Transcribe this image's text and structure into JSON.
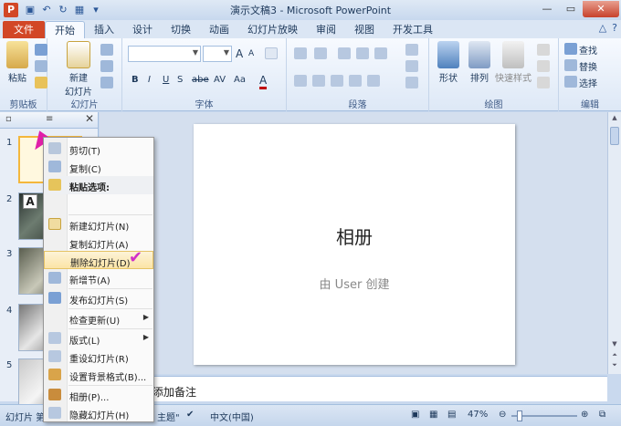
{
  "window": {
    "title": "演示文稿3 - Microsoft PowerPoint",
    "app_icon": "P",
    "controls": [
      "—",
      "▭",
      "✕"
    ]
  },
  "qat": [
    "save-icon",
    "undo-icon",
    "redo-icon",
    "slideshow-icon",
    "customize-icon"
  ],
  "tabs": [
    {
      "label": "文件"
    },
    {
      "label": "开始"
    },
    {
      "label": "插入"
    },
    {
      "label": "设计"
    },
    {
      "label": "切换"
    },
    {
      "label": "动画"
    },
    {
      "label": "幻灯片放映"
    },
    {
      "label": "审阅"
    },
    {
      "label": "视图"
    },
    {
      "label": "开发工具"
    }
  ],
  "ribbon": {
    "clipboard": {
      "label": "剪贴板",
      "paste": "粘贴"
    },
    "slides": {
      "label": "幻灯片",
      "new_slide": "新建\n幻灯片"
    },
    "font": {
      "label": "字体",
      "bold": "B",
      "italic": "I",
      "underline": "U",
      "strike": "S",
      "abc": "abe",
      "av": "AV",
      "aa": "Aa",
      "a_color": "A",
      "grow": "A",
      "shrink": "A"
    },
    "paragraph": {
      "label": "段落"
    },
    "drawing": {
      "label": "绘图",
      "shapes": "形状",
      "arrange": "排列",
      "quick_styles": "快速样式"
    },
    "editing": {
      "label": "编辑",
      "find": "查找",
      "replace": "替换",
      "select": "选择"
    }
  },
  "slides": [
    {
      "num": "1"
    },
    {
      "num": "2"
    },
    {
      "num": "3"
    },
    {
      "num": "4"
    },
    {
      "num": "5"
    }
  ],
  "slide": {
    "title": "相册",
    "subtitle": "由 User 创建"
  },
  "notes": {
    "placeholder": "添加备注"
  },
  "status": {
    "slide_info": "幻灯片 第",
    "theme": "主题\"",
    "language": "中文(中国)",
    "zoom": "47%"
  },
  "context_menu": {
    "items": [
      {
        "label": "剪切(T)",
        "icon": "scissors-icon"
      },
      {
        "label": "复制(C)",
        "icon": "copy-icon"
      },
      {
        "label": "粘贴选项:",
        "icon": "paste-icon",
        "header": true
      },
      {
        "label": "新建幻灯片(N)",
        "icon": "new-slide-icon"
      },
      {
        "label": "复制幻灯片(A)",
        "icon": ""
      },
      {
        "label": "删除幻灯片(D)",
        "icon": "",
        "highlight": true
      },
      {
        "label": "新增节(A)",
        "icon": "section-icon"
      },
      {
        "label": "发布幻灯片(S)",
        "icon": "publish-icon"
      },
      {
        "label": "检查更新(U)",
        "icon": "",
        "submenu": true
      },
      {
        "label": "版式(L)",
        "icon": "layout-icon",
        "submenu": true
      },
      {
        "label": "重设幻灯片(R)",
        "icon": "reset-icon"
      },
      {
        "label": "设置背景格式(B)...",
        "icon": "background-icon"
      },
      {
        "label": "相册(P)...",
        "icon": "album-icon"
      },
      {
        "label": "隐藏幻灯片(H)",
        "icon": "hide-slide-icon"
      }
    ],
    "paste_option": "A"
  }
}
